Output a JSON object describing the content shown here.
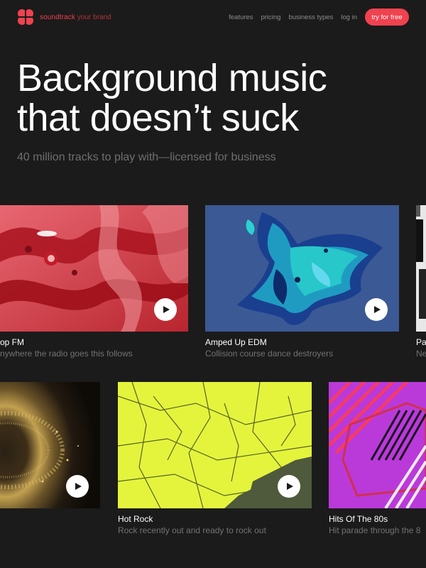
{
  "nav": {
    "brand": "soundtrack",
    "brand_sub": "your brand",
    "links": [
      "features",
      "pricing",
      "business types",
      "log in"
    ],
    "cta": "try for free"
  },
  "hero": {
    "headline_line1": "Background music",
    "headline_line2": "that doesn’t suck",
    "subtitle": "40 million tracks to play with—licensed for business"
  },
  "playlists": [
    {
      "title": "op FM",
      "description": "nywhere the radio goes this follows",
      "art": "red-marble-abstract",
      "play_icon": "play-icon"
    },
    {
      "title": "Amped Up EDM",
      "description": "Collision course dance destroyers",
      "art": "blue-liquid-sculpture",
      "play_icon": "play-icon"
    },
    {
      "title": "Pa",
      "description": "Ne",
      "art": "black-white-noise"
    },
    {
      "title": "",
      "description": "",
      "art": "gold-particle-ring",
      "play_icon": "play-icon"
    },
    {
      "title": "Hot Rock",
      "description": "Rock recently out and ready to rock out",
      "art": "neon-yellow-crackle",
      "play_icon": "play-icon"
    },
    {
      "title": "Hits Of The 80s",
      "description": "Hit parade through the 8",
      "art": "purple-retro-stripes"
    }
  ],
  "colors": {
    "background": "#1b1b1b",
    "accent": "#f0424f",
    "muted_text": "#727272"
  }
}
